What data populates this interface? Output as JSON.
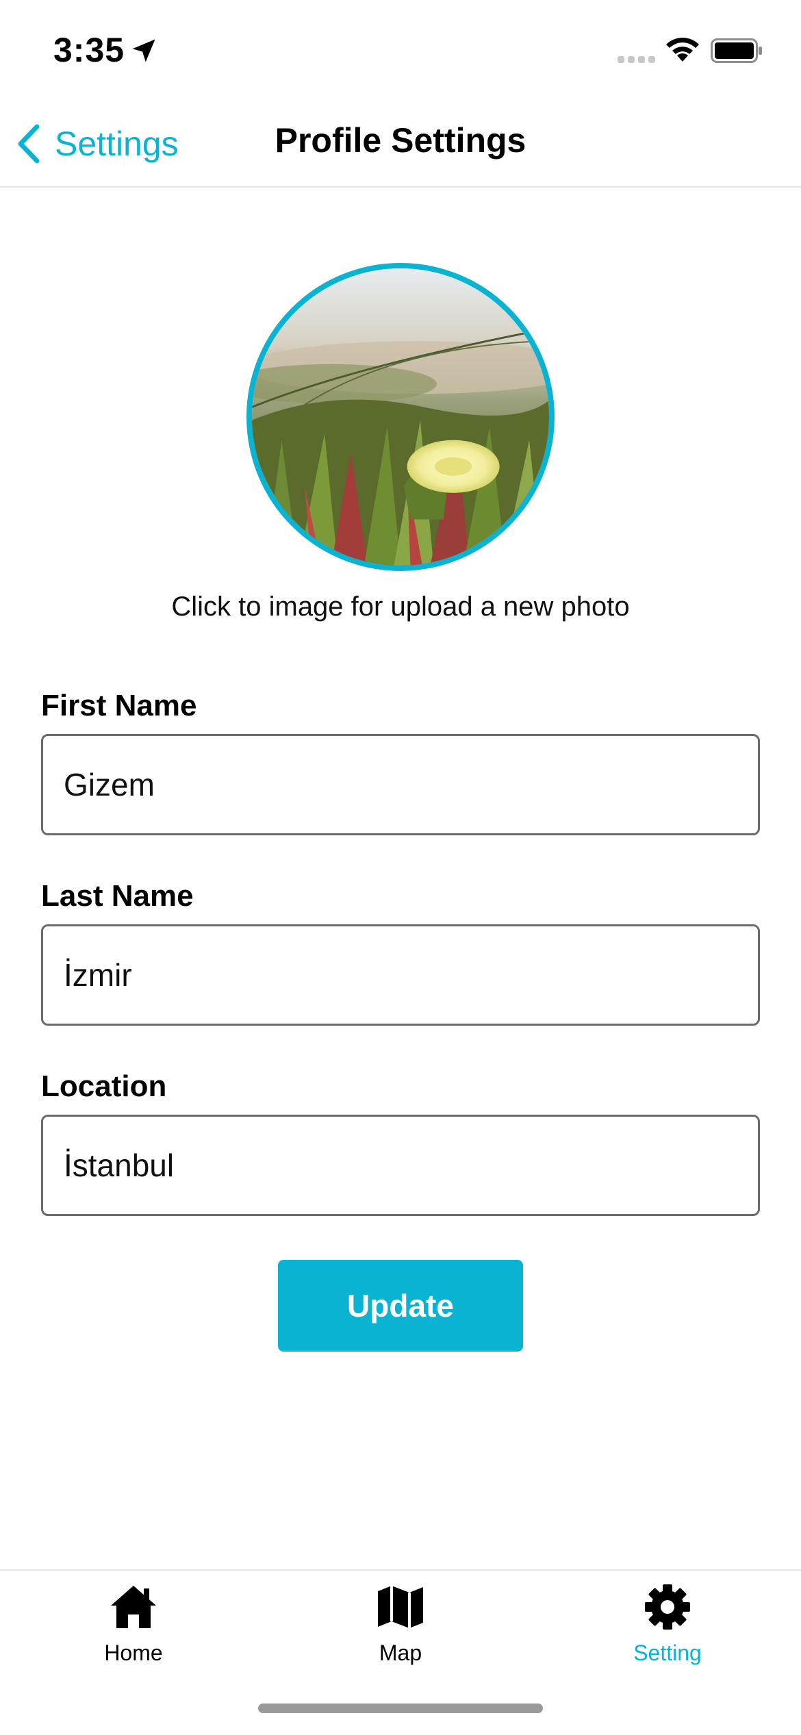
{
  "status_bar": {
    "time": "3:35"
  },
  "nav": {
    "back_label": "Settings",
    "title": "Profile Settings"
  },
  "profile": {
    "upload_hint": "Click to image for upload a new photo"
  },
  "form": {
    "first_name": {
      "label": "First Name",
      "value": "Gizem"
    },
    "last_name": {
      "label": "Last Name",
      "value": "İzmir"
    },
    "location": {
      "label": "Location",
      "value": "İstanbul"
    },
    "submit_label": "Update"
  },
  "tabs": [
    {
      "label": "Home",
      "icon": "home-icon",
      "active": false
    },
    {
      "label": "Map",
      "icon": "map-icon",
      "active": false
    },
    {
      "label": "Setting",
      "icon": "gear-icon",
      "active": true
    }
  ],
  "colors": {
    "accent": "#0ab3d2",
    "input_border": "#6b6b6b"
  }
}
